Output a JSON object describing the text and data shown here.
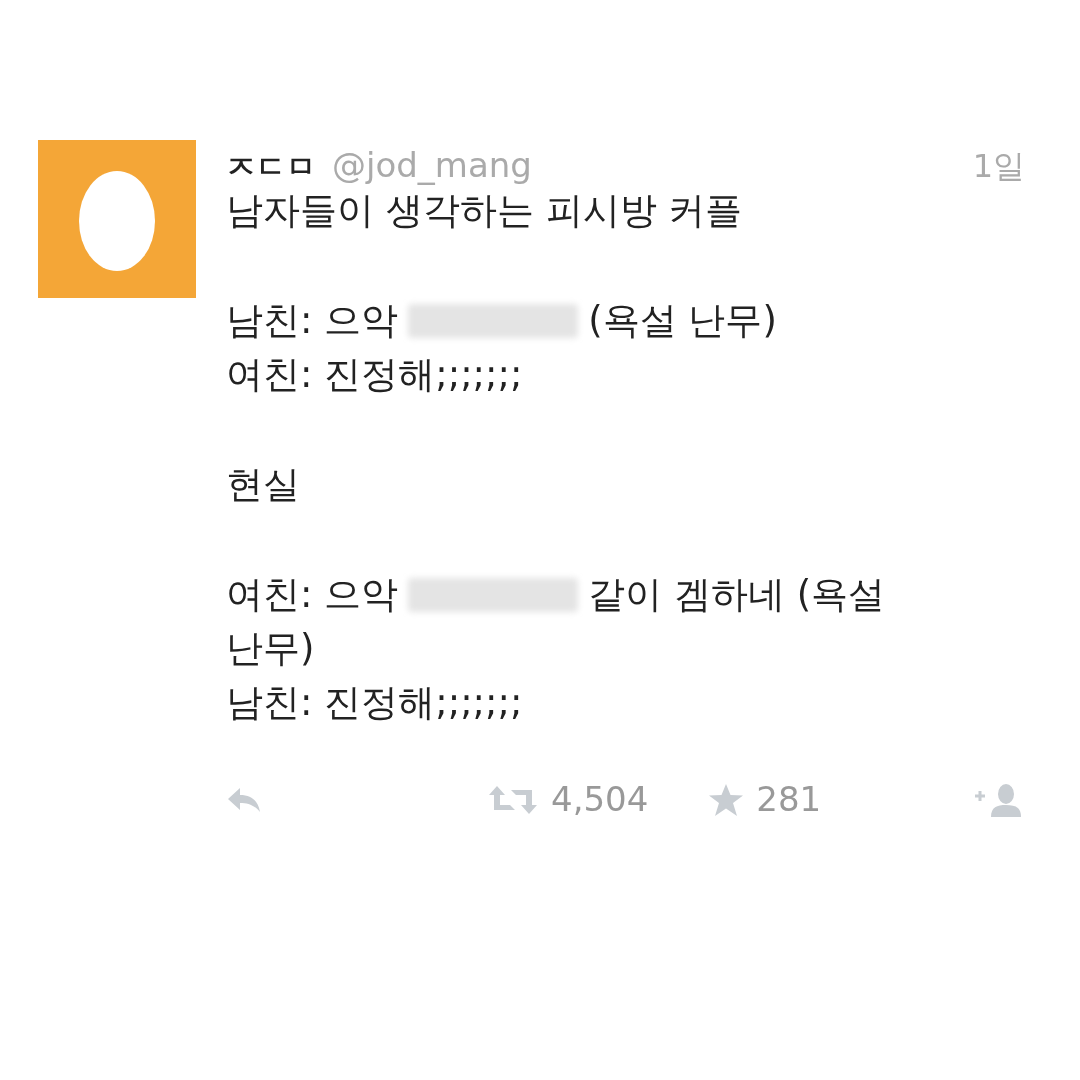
{
  "tweet": {
    "display_name": "ㅈㄷㅁ",
    "handle": "@jod_mang",
    "time": "1일",
    "paragraphs": [
      [
        [
          {
            "kind": "text",
            "text": "남자들이 생각하는 피시방 커플"
          }
        ]
      ],
      [
        [
          {
            "kind": "text",
            "text": "남친: 으악"
          },
          {
            "kind": "censored"
          },
          {
            "kind": "text",
            "text": "(욕설 난무)"
          }
        ],
        [
          {
            "kind": "text",
            "text": "여친: 진정해;;;;;;;"
          }
        ]
      ],
      [
        [
          {
            "kind": "text",
            "text": "현실"
          }
        ]
      ],
      [
        [
          {
            "kind": "text",
            "text": "여친: 으악"
          },
          {
            "kind": "censored"
          },
          {
            "kind": "text",
            "text": "같이 겜하네 (욕설"
          }
        ],
        [
          {
            "kind": "text",
            "text": "난무)"
          }
        ],
        [
          {
            "kind": "text",
            "text": "남친: 진정해;;;;;;;"
          }
        ]
      ]
    ],
    "actions": [
      {
        "kind": "reply"
      },
      {
        "kind": "retweet",
        "count": "4,504"
      },
      {
        "kind": "favorite",
        "count": "281"
      },
      {
        "kind": "follow"
      }
    ]
  }
}
